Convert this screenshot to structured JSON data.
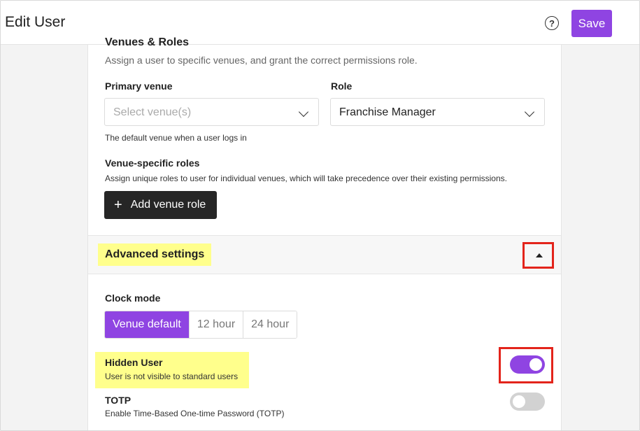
{
  "header": {
    "title": "Edit User",
    "help_icon": "question-circle-icon",
    "save_label": "Save"
  },
  "venues_roles": {
    "heading": "Venues & Roles",
    "description": "Assign a user to specific venues, and grant the correct permissions role.",
    "primary_venue": {
      "label": "Primary venue",
      "placeholder": "Select venue(s)",
      "hint": "The default venue when a user logs in"
    },
    "role": {
      "label": "Role",
      "value": "Franchise Manager"
    },
    "venue_specific": {
      "label": "Venue-specific roles",
      "description": "Assign unique roles to user for individual venues, which will take precedence over their existing permissions.",
      "add_button": "Add venue role",
      "add_icon": "plus-icon"
    }
  },
  "advanced": {
    "title": "Advanced settings",
    "collapse_icon": "caret-up-icon",
    "clock_mode": {
      "label": "Clock mode",
      "options": [
        "Venue default",
        "12 hour",
        "24 hour"
      ],
      "selected": "Venue default"
    },
    "hidden_user": {
      "title": "Hidden User",
      "description": "User is not visible to standard users",
      "enabled": true
    },
    "totp": {
      "title": "TOTP",
      "description": "Enable Time-Based One-time Password (TOTP)",
      "enabled": false
    }
  },
  "colors": {
    "accent": "#8f44e2",
    "highlight": "#ffff8c",
    "annotation": "#e3241b",
    "dark_button": "#262626"
  }
}
